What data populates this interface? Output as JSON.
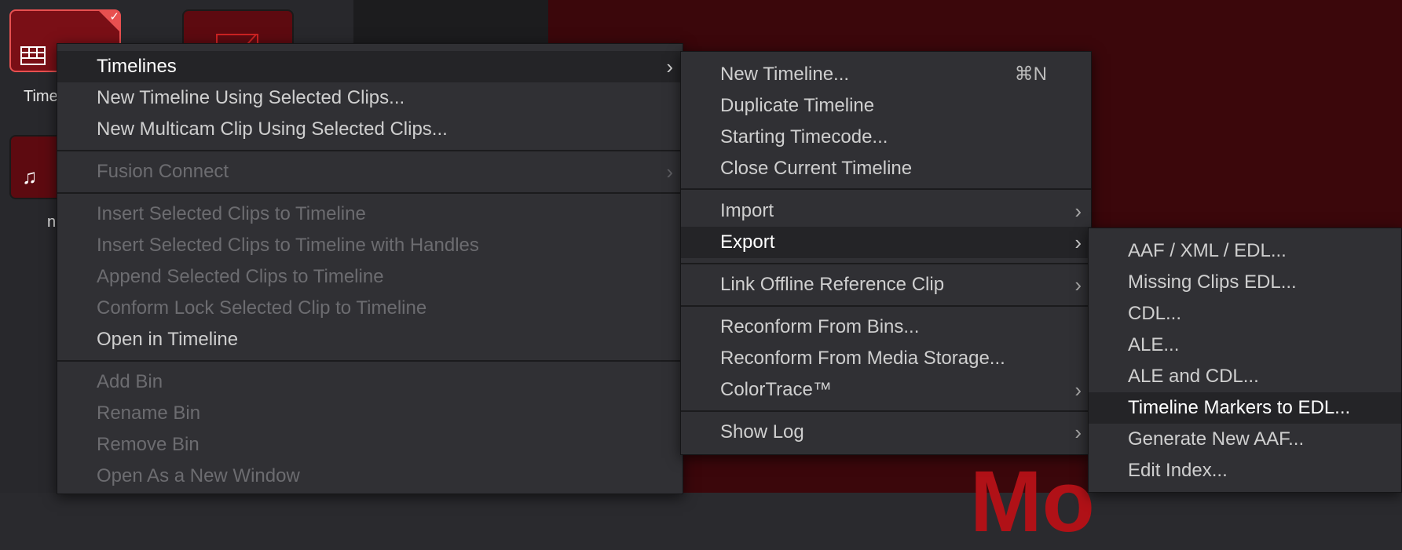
{
  "background": {
    "viewer_text": "Mo",
    "clips": [
      {
        "label": "Time"
      },
      {
        "label": ""
      },
      {
        "label": "n"
      }
    ],
    "check_mark": "✓"
  },
  "menu_main": {
    "items": [
      {
        "label": "Timelines",
        "has_submenu": true,
        "highlighted": true,
        "disabled": false
      },
      {
        "label": "New Timeline Using Selected Clips...",
        "disabled": false
      },
      {
        "label": "New Multicam Clip Using Selected Clips...",
        "disabled": false
      },
      {
        "label": "Fusion Connect",
        "has_submenu": true,
        "disabled": true
      },
      {
        "label": "Insert Selected Clips to Timeline",
        "disabled": true
      },
      {
        "label": "Insert Selected Clips to Timeline with Handles",
        "disabled": true
      },
      {
        "label": "Append Selected Clips to Timeline",
        "disabled": true
      },
      {
        "label": "Conform Lock Selected Clip to Timeline",
        "disabled": true
      },
      {
        "label": "Open in Timeline",
        "disabled": false
      },
      {
        "label": "Add Bin",
        "disabled": true
      },
      {
        "label": "Rename Bin",
        "disabled": true
      },
      {
        "label": "Remove Bin",
        "disabled": true
      },
      {
        "label": "Open As a New Window",
        "disabled": true
      }
    ],
    "arrow_glyph": "›"
  },
  "menu_timelines": {
    "items": [
      {
        "label": "New Timeline...",
        "shortcut": "⌘N"
      },
      {
        "label": "Duplicate Timeline"
      },
      {
        "label": "Starting Timecode..."
      },
      {
        "label": "Close Current Timeline"
      },
      {
        "label": "Import",
        "has_submenu": true
      },
      {
        "label": "Export",
        "has_submenu": true,
        "highlighted": true
      },
      {
        "label": "Link Offline Reference Clip",
        "has_submenu": true
      },
      {
        "label": "Reconform From Bins..."
      },
      {
        "label": "Reconform From Media Storage..."
      },
      {
        "label": "ColorTrace™",
        "has_submenu": true
      },
      {
        "label": "Show Log",
        "has_submenu": true
      }
    ]
  },
  "menu_export": {
    "items": [
      {
        "label": "AAF / XML / EDL..."
      },
      {
        "label": "Missing Clips EDL..."
      },
      {
        "label": "CDL..."
      },
      {
        "label": "ALE..."
      },
      {
        "label": "ALE and CDL..."
      },
      {
        "label": "Timeline Markers to EDL...",
        "highlighted": true
      },
      {
        "label": "Generate New AAF..."
      },
      {
        "label": "Edit Index..."
      }
    ]
  },
  "colors": {
    "menu_bg": "#303034",
    "highlight_bg": "#242427",
    "disabled_text": "#6c6c70",
    "viewer_bg": "#3b070b",
    "accent_red": "#e85050"
  }
}
